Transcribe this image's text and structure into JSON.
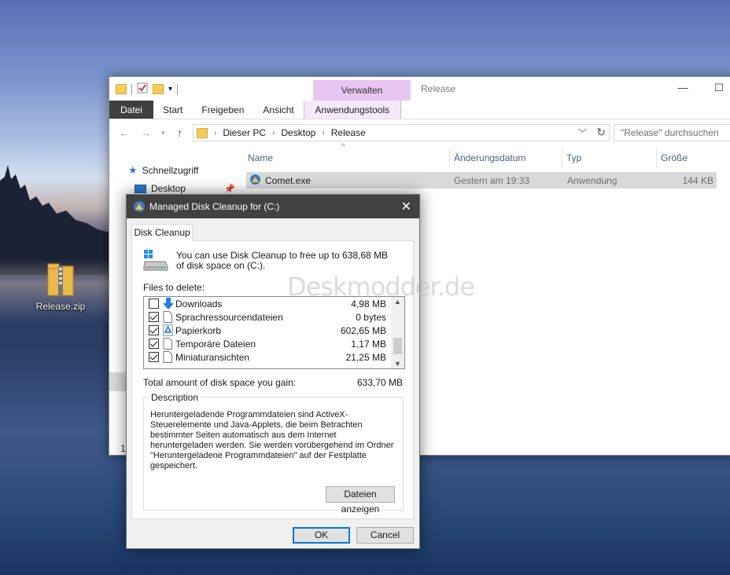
{
  "desktop": {
    "icon_label": "Release.zip",
    "watermark": "Deskmodder.de"
  },
  "explorer": {
    "context_tab_top": "Verwalten",
    "window_title": "Release",
    "ribbon_tabs": [
      "Datei",
      "Start",
      "Freigeben",
      "Ansicht",
      "Anwendungstools"
    ],
    "address": {
      "crumbs": [
        "Dieser PC",
        "Desktop",
        "Release"
      ]
    },
    "search_placeholder": "\"Release\" durchsuchen",
    "nav": {
      "quick_access": "Schnellzugriff",
      "desktop": "Desktop",
      "count_partial": "1"
    },
    "columns": [
      "Name",
      "Änderungsdatum",
      "Typ",
      "Größe"
    ],
    "files": [
      {
        "name": "Comet.exe",
        "date": "Gestern am 19:33",
        "type": "Anwendung",
        "size": "144 KB"
      }
    ]
  },
  "dialog": {
    "title": "Managed Disk Cleanup for  (C:)",
    "tab": "Disk Cleanup",
    "intro": "You can use Disk Cleanup to free up to 638,68 MB of disk space on  (C:).",
    "files_label": "Files to delete:",
    "items": [
      {
        "name": "Downloads",
        "size": "4,98 MB",
        "checked": false,
        "icon": "download-arrow-icon"
      },
      {
        "name": "Sprachressourcendateien",
        "size": "0 bytes",
        "checked": true,
        "icon": "file-icon"
      },
      {
        "name": "Papierkorb",
        "size": "602,65 MB",
        "checked": true,
        "icon": "recycle-bin-icon"
      },
      {
        "name": "Temporäre Dateien",
        "size": "1,17 MB",
        "checked": true,
        "icon": "file-icon"
      },
      {
        "name": "Miniaturansichten",
        "size": "21,25 MB",
        "checked": true,
        "icon": "file-icon"
      }
    ],
    "total_label": "Total amount of disk space you gain:",
    "total_value": "633,70 MB",
    "description_legend": "Description",
    "description_text": "Heruntergeladende Programmdateien sind ActiveX-Steuerelemente und Java-Applets, die beim Betrachten bestimmter Seiten automatisch aus dem Internet heruntergeladen werden. Sie werden vorübergehend im Ordner \"Heruntergeladene Programmdateien\" auf der Festplatte gespeichert.",
    "show_files_button": "Dateien anzeigen",
    "ok_button": "OK",
    "cancel_button": "Cancel"
  }
}
